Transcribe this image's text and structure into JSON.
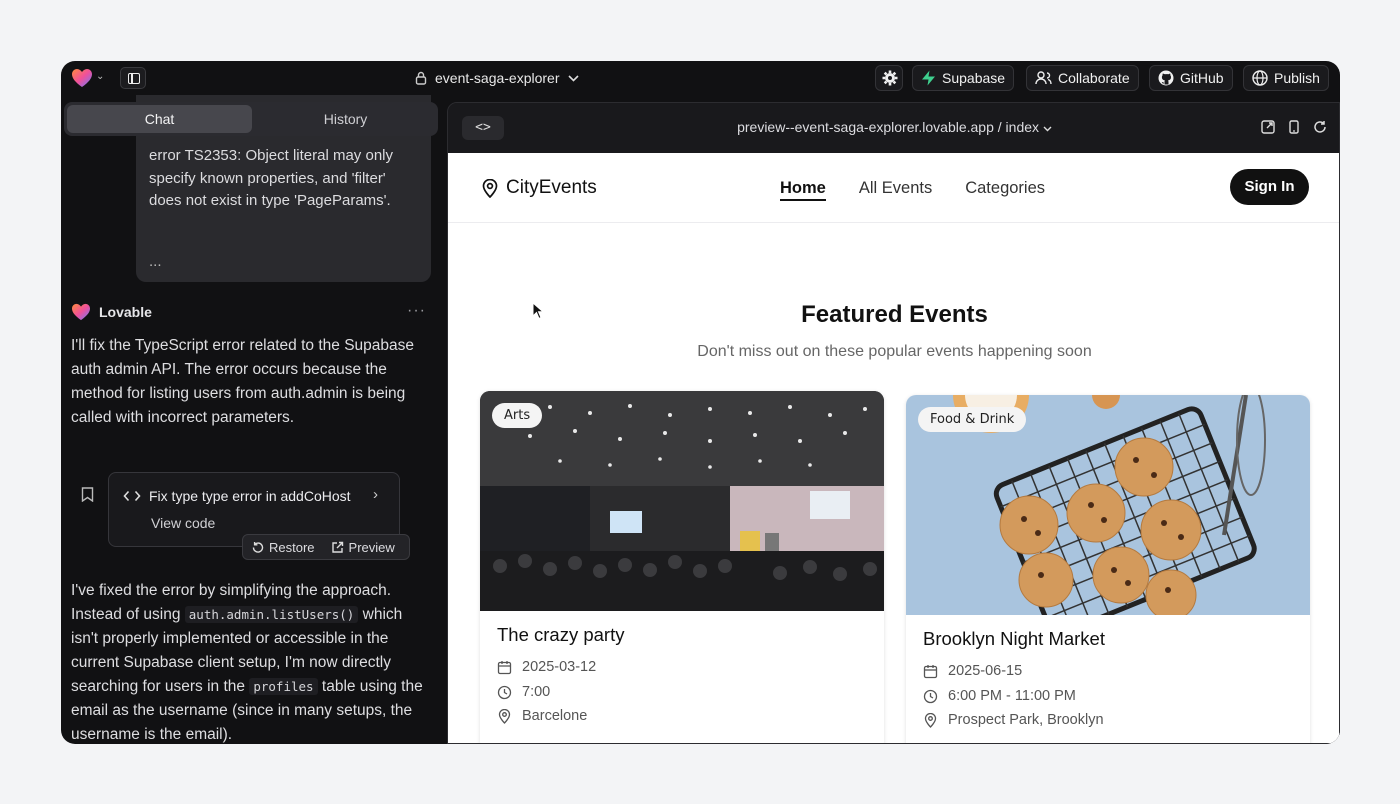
{
  "topbar": {
    "project_name": "event-saga-explorer",
    "buttons": {
      "supabase": "Supabase",
      "collaborate": "Collaborate",
      "github": "GitHub",
      "publish": "Publish"
    }
  },
  "chat": {
    "tabs": [
      "Chat",
      "History"
    ],
    "user_message": {
      "lines": [
        "error TS2353: Object literal may only",
        "specify known properties, and 'filter'",
        "does not exist in type 'PageParams'."
      ],
      "ellipsis": "..."
    },
    "assistant_name": "Lovable",
    "assistant_more": "···",
    "message_1": "I'll fix the TypeScript error related to the Supabase auth admin API. The error occurs because the method for listing users from auth.admin is being called with incorrect parameters.",
    "action_card": {
      "title": "Fix type type error in addCoHost",
      "view_code": "View code"
    },
    "restore_label": "Restore",
    "preview_label": "Preview",
    "message_2": {
      "p1": "I've fixed the error by simplifying the approach. Instead of using",
      "code1": "auth.admin.listUsers()",
      "p2": "which isn't properly implemented or accessible in the current Supabase client setup, I'm now directly searching for users in the",
      "code2": "profiles",
      "p3": "table using the email as the username (since in many setups, the username is the email)."
    }
  },
  "preview": {
    "code_toggle": "<>",
    "url": "preview--event-saga-explorer.lovable.app / index"
  },
  "site": {
    "brand": "CityEvents",
    "nav": [
      "Home",
      "All Events",
      "Categories"
    ],
    "sign_in": "Sign In",
    "featured_title": "Featured Events",
    "featured_subtitle": "Don't miss out on these popular events happening soon",
    "events": [
      {
        "badge": "Arts",
        "title": "The crazy party",
        "date": "2025-03-12",
        "time": "7:00",
        "location": "Barcelone"
      },
      {
        "badge": "Food & Drink",
        "title": "Brooklyn Night Market",
        "date": "2025-06-15",
        "time": "6:00 PM - 11:00 PM",
        "location": "Prospect Park, Brooklyn"
      }
    ]
  },
  "colors": {
    "app_bg": "#111113",
    "panel": "#2a2a2e",
    "site_bg": "#ffffff",
    "accent": "#111111",
    "supabase_green": "#3ecf8e"
  }
}
